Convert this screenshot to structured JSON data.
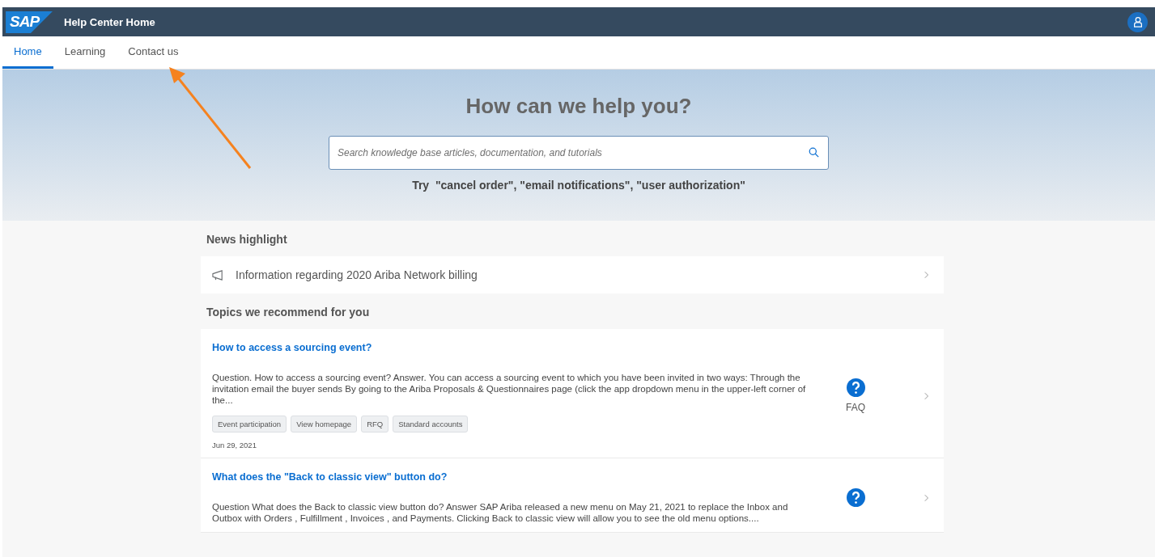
{
  "header": {
    "logo": "SAP",
    "title": "Help Center Home"
  },
  "nav_tabs": [
    {
      "label": "Home",
      "selected": true
    },
    {
      "label": "Learning",
      "selected": false
    },
    {
      "label": "Contact us",
      "selected": false
    }
  ],
  "hero": {
    "heading": "How can we help you?",
    "search": {
      "placeholder": "Search knowledge base articles, documentation, and tutorials"
    },
    "suggestion": "Try  \"cancel order\", \"email notifications\", \"user authorization\""
  },
  "news": {
    "heading": "News highlight",
    "item": "Information regarding 2020 Ariba Network billing"
  },
  "topics": {
    "heading": "Topics we recommend for you",
    "cards": [
      {
        "title": "How to access a sourcing event?",
        "body": "Question. How to access a sourcing event? Answer. You can access a sourcing event to which you have been invited in two ways: Through the invitation email the buyer sends By going to the Ariba Proposals & Questionnaires page (click the app dropdown menu in the upper-left corner of the...",
        "tags": [
          "Event participation",
          "View homepage",
          "RFQ",
          "Standard accounts"
        ],
        "date": "Jun 29, 2021",
        "type": "FAQ"
      },
      {
        "title": "What does the \"Back to classic view\" button do?",
        "body": "Question What does the Back to classic view button do? Answer SAP Ariba released a new menu on May 21, 2021 to replace the Inbox and Outbox with Orders , Fulfillment , Invoices , and Payments. Clicking Back to classic view will allow you to see the old menu options...."
      }
    ]
  }
}
